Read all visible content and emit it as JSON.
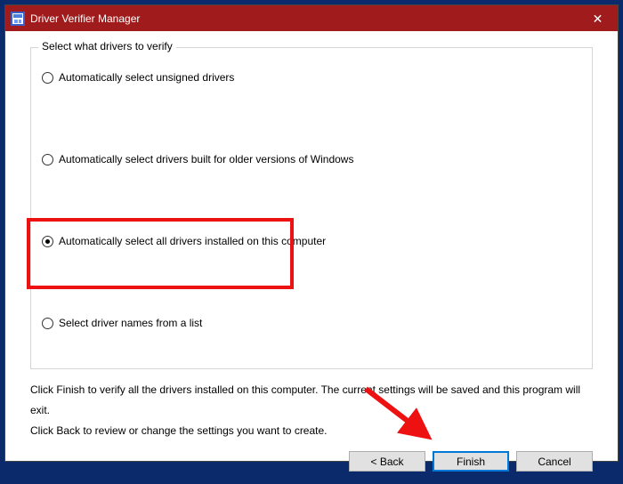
{
  "window": {
    "title": "Driver Verifier Manager"
  },
  "group": {
    "legend": "Select what drivers to verify"
  },
  "options": {
    "opt1": "Automatically select unsigned drivers",
    "opt2": "Automatically select drivers built for older versions of Windows",
    "opt3": "Automatically select all drivers installed on this computer",
    "opt4": "Select driver names from a list",
    "selected": "opt3"
  },
  "instructions": {
    "line1": "Click Finish to verify all the drivers installed on this computer. The current settings will be saved and this program will exit.",
    "line2": "Click Back to review or change the settings you want to create."
  },
  "buttons": {
    "back": "< Back",
    "finish": "Finish",
    "cancel": "Cancel"
  },
  "annotation": {
    "highlight_color": "#ee1111",
    "arrow_color": "#ee1111"
  }
}
